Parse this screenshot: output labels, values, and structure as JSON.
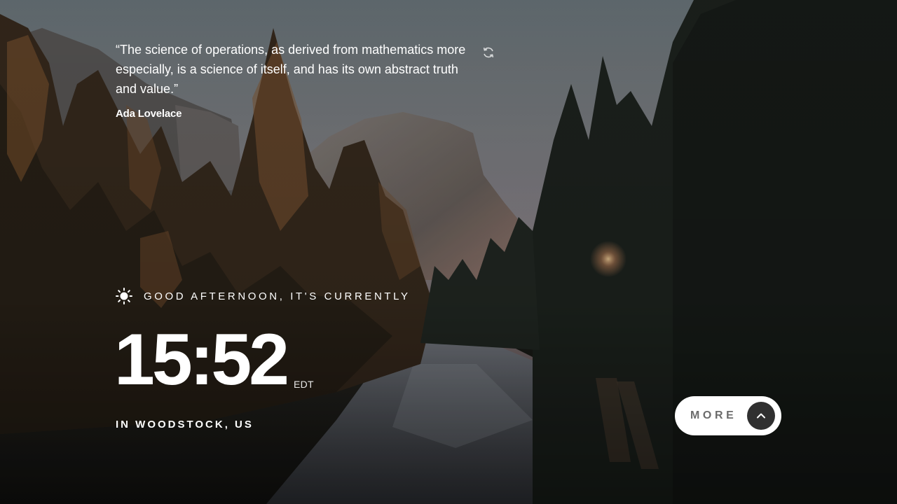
{
  "quote": {
    "text": "“The science of operations, as derived from mathematics more especially, is a science of itself, and has its own abstract truth and value.”",
    "author": "Ada Lovelace",
    "refresh_icon": "refresh-icon"
  },
  "greeting": {
    "icon": "sun-icon",
    "text": "GOOD AFTERNOON, IT'S CURRENTLY"
  },
  "clock": {
    "time": "15:52",
    "timezone": "EDT"
  },
  "location": {
    "text": "IN WOODSTOCK, US"
  },
  "more_button": {
    "label": "MORE",
    "icon": "chevron-up-icon"
  },
  "colors": {
    "text": "#ffffff",
    "button_bg": "#ffffff",
    "button_label": "#6b6b6b",
    "button_circle": "#303030"
  }
}
